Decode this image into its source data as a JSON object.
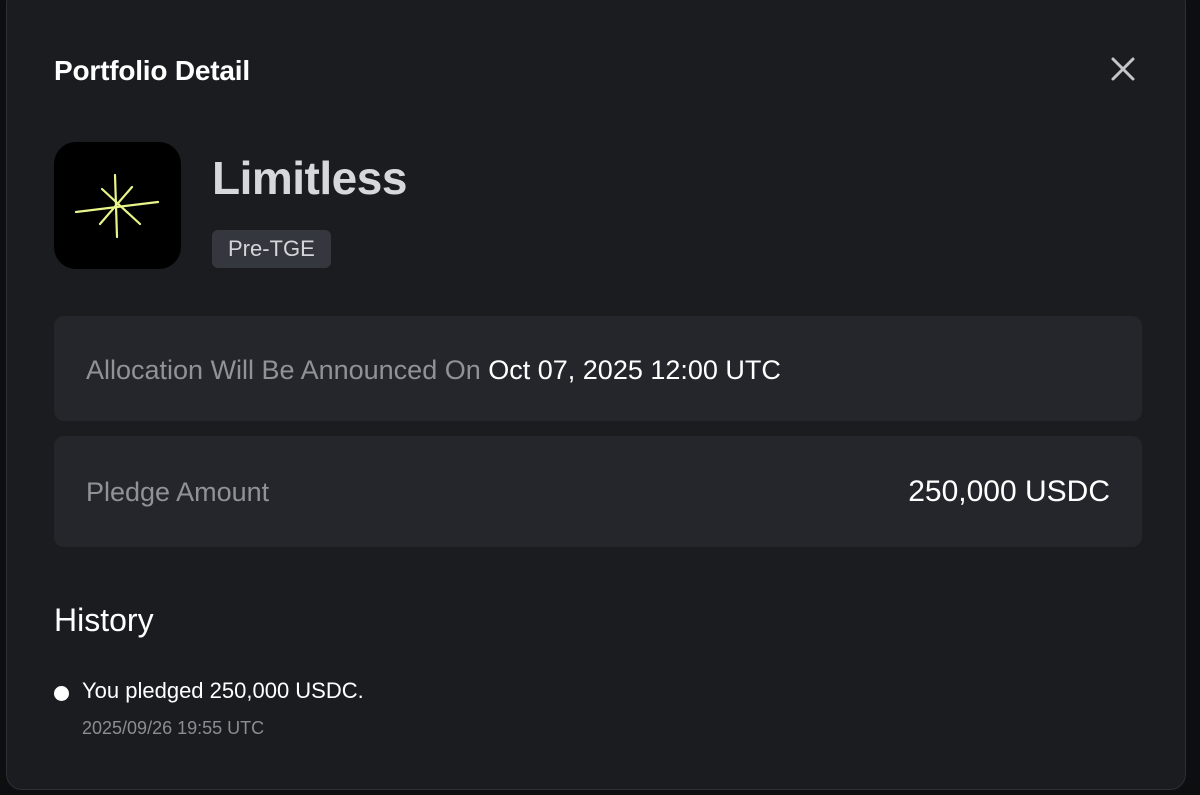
{
  "modal": {
    "title": "Portfolio Detail",
    "close_icon": "close-icon"
  },
  "project": {
    "name": "Limitless",
    "badge": "Pre-TGE",
    "logo_icon": "limitless-logo",
    "logo_color": "#e9f58a"
  },
  "allocation": {
    "label": "Allocation Will Be Announced On",
    "date": "Oct 07, 2025 12:00 UTC"
  },
  "pledge": {
    "label": "Pledge Amount",
    "value": "250,000 USDC"
  },
  "history": {
    "title": "History",
    "items": [
      {
        "text": "You pledged 250,000 USDC.",
        "timestamp": "2025/09/26 19:55 UTC"
      }
    ]
  }
}
